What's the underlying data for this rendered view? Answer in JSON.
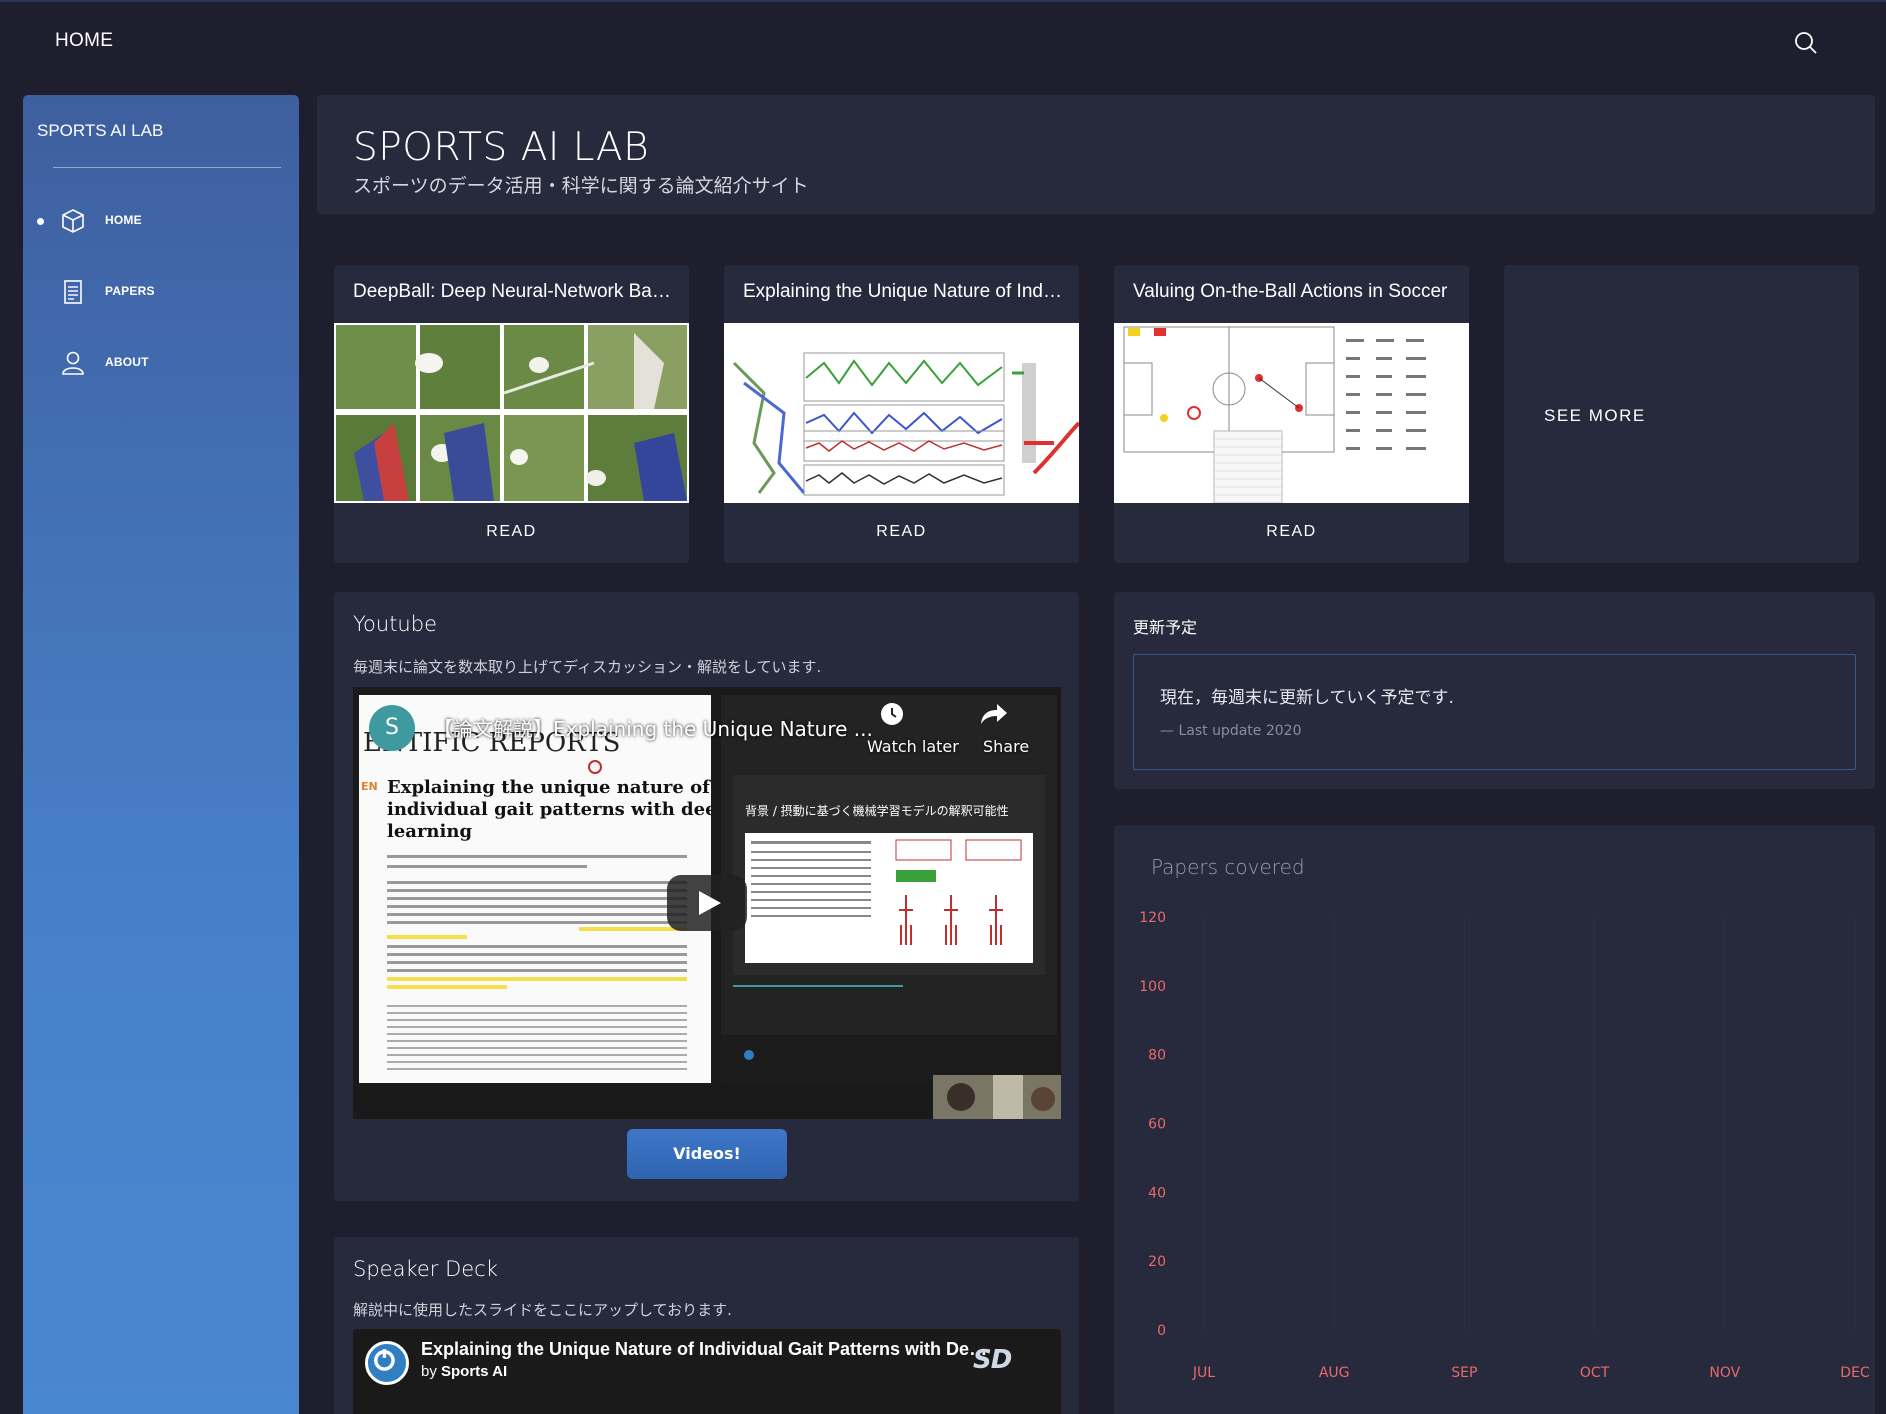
{
  "navbar": {
    "brand": "HOME",
    "search_icon": "search-icon"
  },
  "sidebar": {
    "logo": "SPORTS AI LAB",
    "items": [
      {
        "label": "HOME",
        "icon": "cube-icon",
        "active": true
      },
      {
        "label": "PAPERS",
        "icon": "document-icon",
        "active": false
      },
      {
        "label": "ABOUT",
        "icon": "user-icon",
        "active": false
      }
    ]
  },
  "header": {
    "title": "SPORTS AI LAB",
    "subtitle": "スポーツのデータ活用・科学に関する論文紹介サイト"
  },
  "papers": [
    {
      "title": "DeepBall: Deep Neural-Network Ball Detector",
      "action": "READ"
    },
    {
      "title": "Explaining the Unique Nature of Individual Gait Patterns",
      "action": "READ"
    },
    {
      "title": "Valuing On-the-Ball Actions in Soccer",
      "action": "READ"
    }
  ],
  "see_more": "SEE MORE",
  "youtube": {
    "heading": "Youtube",
    "description": "毎週末に論文を数本取り上げてディスカッション・解説をしています.",
    "video": {
      "channel_initial": "S",
      "title": "【論文解説】Explaining the Unique Nature ...",
      "watch_later": "Watch later",
      "share": "Share",
      "paper_heading": "Explaining the unique nature of individual gait patterns with deep learning",
      "slide_heading": "背景 / 摂動に基づく機械学習モデルの解釈可能性"
    },
    "button": "Videos!"
  },
  "speaker_deck": {
    "heading": "Speaker Deck",
    "description": "解説中に使用したスライドをここにアップしております.",
    "embed_title": "Explaining the Unique Nature of Individual Gait Patterns with Deep Learning",
    "by_prefix": "by",
    "author": "Sports AI",
    "mark": "SD"
  },
  "update": {
    "heading": "更新予定",
    "quote": "現在，毎週末に更新していく予定です.",
    "meta": "— Last update 2020"
  },
  "chart_data": {
    "type": "line",
    "title": "Papers covered",
    "categories": [
      "JUL",
      "AUG",
      "SEP",
      "OCT",
      "NOV",
      "DEC"
    ],
    "y_ticks": [
      "120",
      "100",
      "80",
      "60",
      "40",
      "20",
      "0"
    ],
    "ylim": [
      0,
      120
    ],
    "series": [],
    "colors": {
      "tick_label": "#e96a6a",
      "grid": "#2f2f45"
    }
  },
  "colors": {
    "background": "#1e1e2f",
    "card": "#27293d",
    "sidebar_top": "#3e5f9f",
    "sidebar_bottom": "#4a87d1",
    "accent_blue": "#3e77c8"
  }
}
